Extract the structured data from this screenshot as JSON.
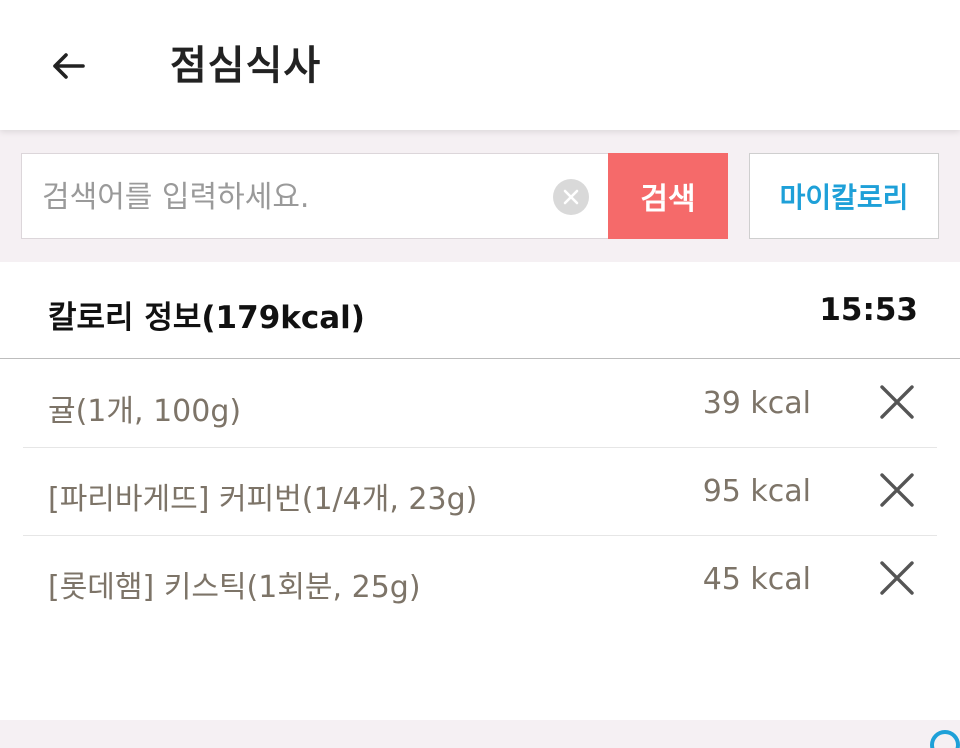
{
  "header": {
    "title": "점심식사",
    "back_icon": "arrow-left-icon"
  },
  "search": {
    "placeholder": "검색어를 입력하세요.",
    "value": "",
    "clear_icon": "clear-circle-icon",
    "search_label": "검색",
    "my_calorie_label": "마이칼로리"
  },
  "info": {
    "label": "칼로리 정보(179kcal)",
    "time": "15:53"
  },
  "foods": [
    {
      "name": "귤(1개, 100g)",
      "kcal": "39 kcal"
    },
    {
      "name": "[파리바게뜨] 커피번(1/4개, 23g)",
      "kcal": "95 kcal"
    },
    {
      "name": "[롯데햄] 키스틱(1회분, 25g)",
      "kcal": "45 kcal"
    }
  ],
  "colors": {
    "search_button": "#f56a6a",
    "my_calorie_text": "#1ea0d8",
    "band_background": "#f5f0f3",
    "food_text": "#7d7468"
  }
}
